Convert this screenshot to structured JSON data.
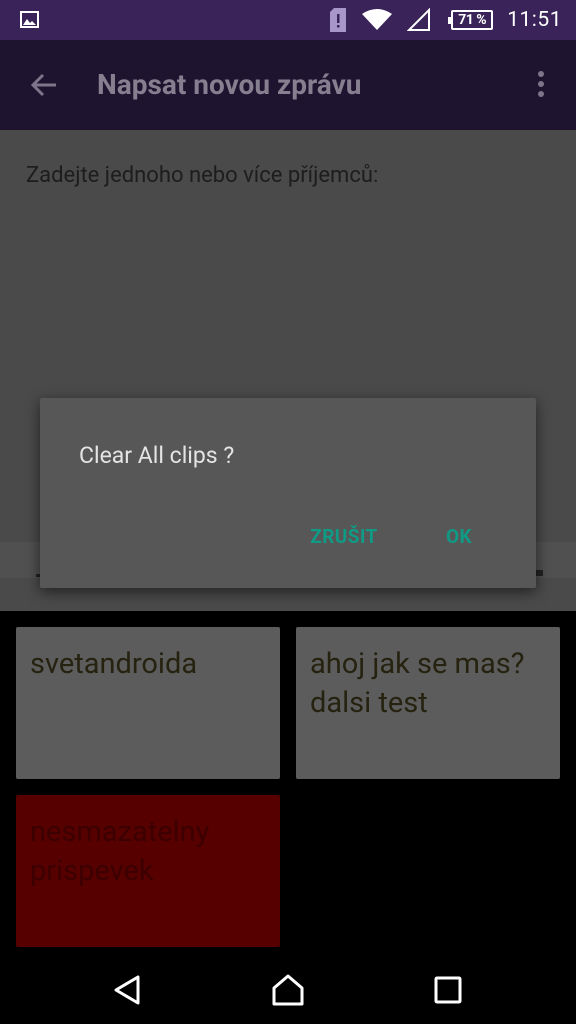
{
  "status_bar": {
    "battery_level": "71 %",
    "time": "11:51",
    "icons": [
      "image-notification-icon",
      "sim-alert-icon",
      "wifi-icon",
      "signal-icon",
      "battery-icon"
    ]
  },
  "app_bar": {
    "title": "Napsat novou zprávu"
  },
  "compose": {
    "recipients_label": "Zadejte jednoho nebo více příjemců:"
  },
  "dialog": {
    "message": "Clear All clips ?",
    "cancel_label": "ZRUŠIT",
    "ok_label": "OK",
    "accent_color": "#0f9a86"
  },
  "clips": [
    {
      "text": "svetandroida"
    },
    {
      "text": "ahoj jak se mas?dalsi test"
    },
    {
      "text": "nesmazatelny prispevek"
    }
  ],
  "colors": {
    "status_bar": "#3a2359",
    "app_bar": "#1e1430",
    "scrim_content": "#4a4a4a",
    "clip_tile": "#5c5c5c",
    "pinned_clip_tile": "#560000"
  }
}
